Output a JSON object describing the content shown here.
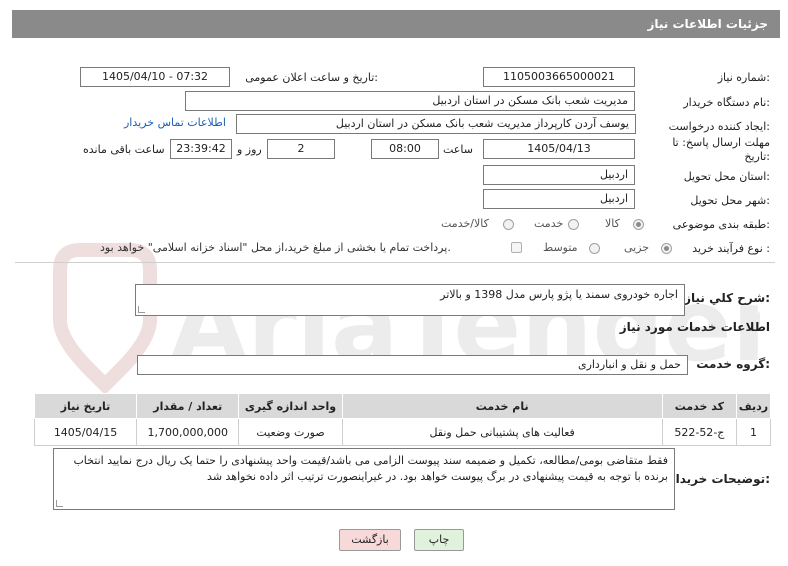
{
  "header": {
    "title": "جزئیات اطلاعات نیاز"
  },
  "fields": {
    "need_number_label": "شماره نیاز:",
    "need_number": "1105003665000021",
    "announce_label": "تاریخ و ساعت اعلان عمومی:",
    "announce_value": "1405/04/10 - 07:32",
    "buyer_org_label": "نام دستگاه خریدار:",
    "buyer_org": "مدیریت شعب بانک مسکن در استان اردبیل",
    "creator_label": "ایجاد کننده درخواست:",
    "creator": "یوسف  آردن کارپرداز مدیریت شعب بانک مسکن در استان اردبیل",
    "contact_link": "اطلاعات تماس خریدار",
    "deadline_label": "مهلت ارسال پاسخ: تا تاریخ:",
    "deadline_date": "1405/04/13",
    "time_label": "ساعت",
    "deadline_time": "08:00",
    "days_value": "2",
    "days_label": "روز و",
    "remaining_time": "23:39:42",
    "remaining_label": "ساعت باقی مانده",
    "province_label": "استان محل تحویل:",
    "province": "اردبیل",
    "city_label": "شهر محل تحویل:",
    "city": "اردبیل",
    "category_label": "طبقه بندی موضوعی:",
    "category_options": [
      "کالا",
      "خدمت",
      "کالا/خدمت"
    ],
    "process_label": "نوع فرآیند خرید :",
    "process_options": [
      "جزیی",
      "متوسط"
    ],
    "payment_note": "پرداخت تمام یا بخشی از مبلغ خرید،از محل \"اسناد خزانه اسلامی\" خواهد بود."
  },
  "description": {
    "label": "شرح كلي نياز:",
    "value": "اجاره خودروی سمند یا پژو پارس مدل 1398 و بالاتر"
  },
  "services": {
    "section_title": "اطلاعات خدمات مورد نياز",
    "group_label": "گروه خدمت:",
    "group_value": "حمل و نقل و انبارداری",
    "columns": [
      "ردیف",
      "کد خدمت",
      "نام خدمت",
      "واحد اندازه گیری",
      "تعداد / مقدار",
      "تاریخ نیاز"
    ],
    "rows": [
      [
        "1",
        "ج-52-522",
        "فعالیت های پشتیبانی حمل ونقل",
        "صورت وضعیت",
        "1,700,000,000",
        "1405/04/15"
      ]
    ]
  },
  "buyer_notes": {
    "label": "توضیحات خریدار:",
    "value": "فقط متقاضی بومی/مطالعه، تکمیل و ضمیمه سند پیوست الزامی می باشد/قیمت واحد پیشنهادی را حتما یک ریال درج نمایید انتخاب برنده با توجه به قیمت پیشنهادی در برگ پیوست خواهد بود. در غیراینصورت ترتیب اثر داده نخواهد شد"
  },
  "buttons": {
    "print": "چاپ",
    "back": "بازگشت"
  },
  "colors": {
    "header_bg": "#8a8a8a",
    "link": "#1a5fb4",
    "back_btn_bg": "#f7d9d9",
    "print_btn_bg": "#e1f2dc"
  }
}
